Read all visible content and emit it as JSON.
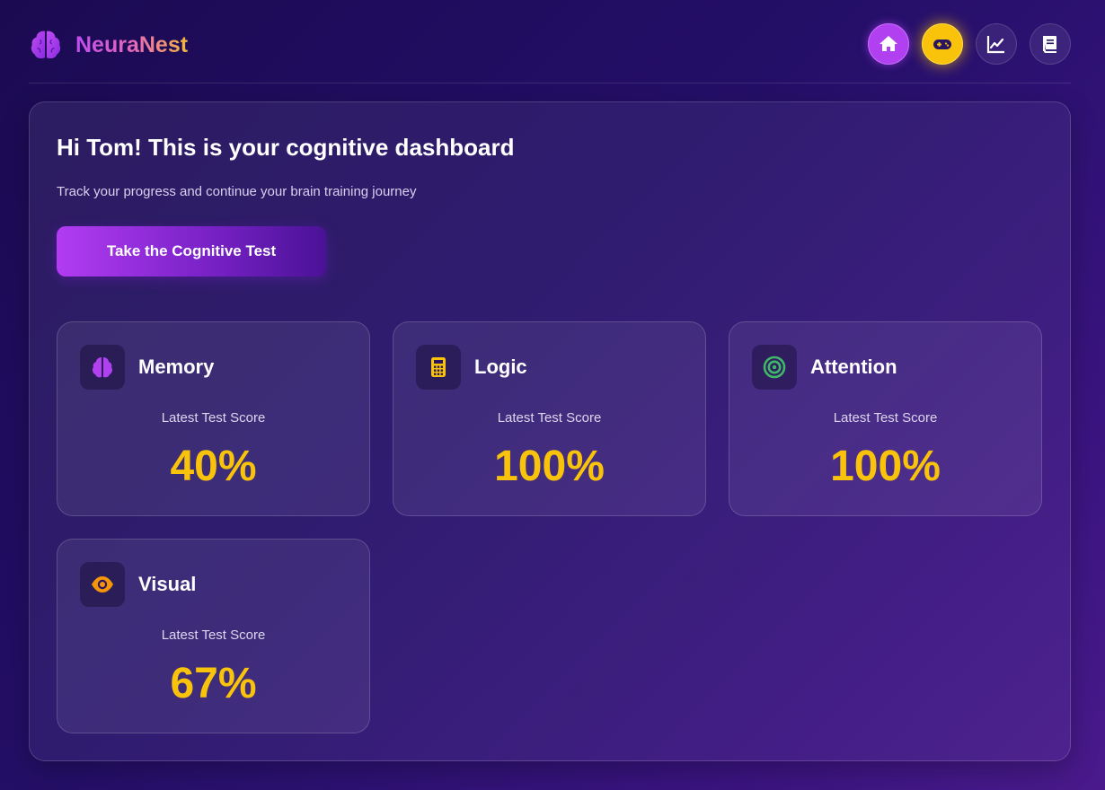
{
  "app": {
    "name": "NeuraNest",
    "logo_icon": "brain-icon"
  },
  "nav": {
    "items": [
      {
        "icon": "home-icon",
        "active": true
      },
      {
        "icon": "gamepad-icon",
        "highlight": true
      },
      {
        "icon": "chart-line-icon"
      },
      {
        "icon": "book-icon"
      }
    ]
  },
  "dashboard": {
    "title": "Hi Tom! This is your cognitive dashboard",
    "subtitle": "Track your progress and continue your brain training journey",
    "cta_label": "Take the Cognitive Test"
  },
  "cards": [
    {
      "title": "Memory",
      "label": "Latest Test Score",
      "score": "40%",
      "icon": "brain-icon",
      "icon_color": "#b040f0"
    },
    {
      "title": "Logic",
      "label": "Latest Test Score",
      "score": "100%",
      "icon": "calculator-icon",
      "icon_color": "#f8c30a"
    },
    {
      "title": "Attention",
      "label": "Latest Test Score",
      "score": "100%",
      "icon": "target-icon",
      "icon_color": "#3fb86a"
    },
    {
      "title": "Visual",
      "label": "Latest Test Score",
      "score": "67%",
      "icon": "eye-icon",
      "icon_color": "#f5960a"
    }
  ],
  "colors": {
    "accent_purple": "#b040f0",
    "accent_yellow": "#f8c30a",
    "score_color": "#f8c30a"
  }
}
